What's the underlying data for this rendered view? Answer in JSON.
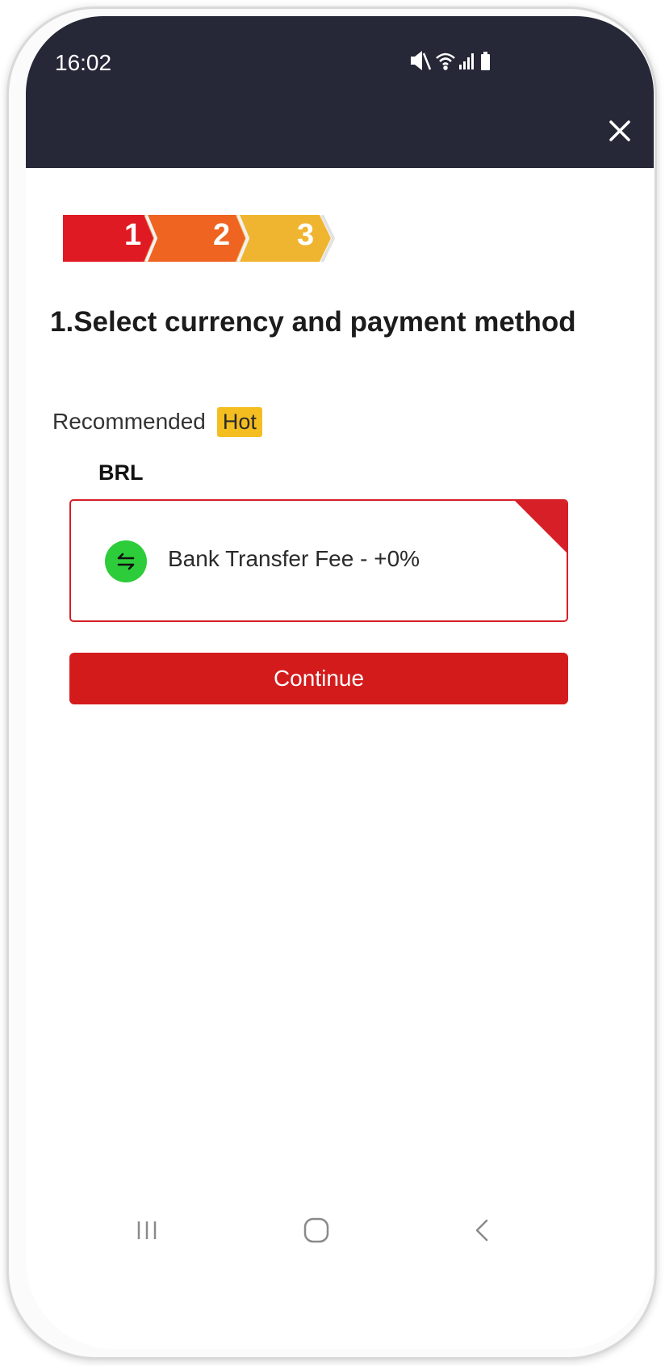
{
  "status_bar": {
    "time": "16:02"
  },
  "steps": [
    {
      "number": "1",
      "color": "#e01a22"
    },
    {
      "number": "2",
      "color": "#ee6420"
    },
    {
      "number": "3",
      "color": "#f0b530"
    }
  ],
  "page": {
    "title": "1.Select currency and payment method"
  },
  "recommended": {
    "label": "Recommended",
    "badge": "Hot"
  },
  "currency": {
    "code": "BRL"
  },
  "payment_method": {
    "label": "Bank Transfer Fee - +0%",
    "selected": true
  },
  "continue_button": {
    "label": "Continue"
  },
  "colors": {
    "header": "#262838",
    "accent_red": "#d41b1c",
    "hot_badge": "#f4be21",
    "method_icon": "#2dcc3a"
  },
  "icons": {
    "close": "close-icon",
    "method": "transfer-arrows-icon",
    "nav_recent": "recent-apps-icon",
    "nav_home": "home-icon",
    "nav_back": "back-icon"
  }
}
